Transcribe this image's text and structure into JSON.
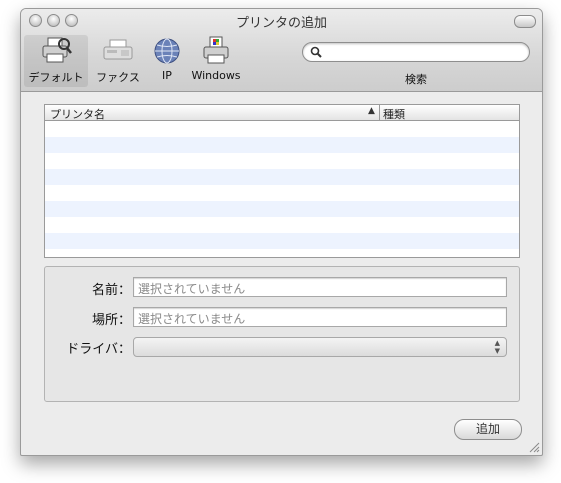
{
  "window": {
    "title": "プリンタの追加"
  },
  "toolbar": {
    "items": [
      {
        "label": "デフォルト",
        "icon": "default-printer-icon"
      },
      {
        "label": "ファクス",
        "icon": "fax-icon"
      },
      {
        "label": "IP",
        "icon": "ip-globe-icon"
      },
      {
        "label": "Windows",
        "icon": "windows-printer-icon"
      }
    ],
    "search": {
      "label": "検索",
      "value": ""
    }
  },
  "printer_list": {
    "columns": {
      "name": "プリンタ名",
      "kind": "種類"
    },
    "rows": []
  },
  "details": {
    "name_label": "名前：",
    "name_value": "選択されていません",
    "location_label": "場所：",
    "location_value": "選択されていません",
    "driver_label": "ドライバ：",
    "driver_value": ""
  },
  "buttons": {
    "add": "追加"
  },
  "colors": {
    "row_stripe": "#edf3fe",
    "window_bg": "#ececec"
  }
}
